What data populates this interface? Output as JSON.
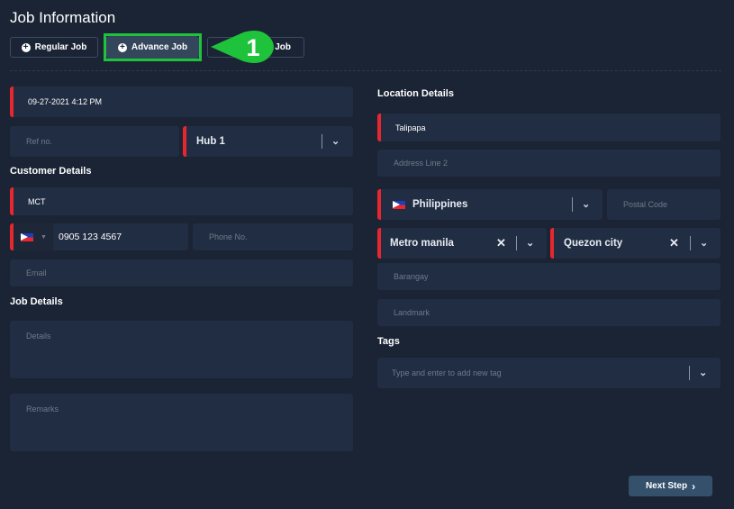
{
  "header": {
    "title": "Job Information"
  },
  "job_types": [
    {
      "label": "Regular Job"
    },
    {
      "label": "Advance Job"
    },
    {
      "label": "Job"
    }
  ],
  "annotation": {
    "number": "1",
    "color": "#1fc23b"
  },
  "form": {
    "datetime": "09-27-2021 4:12 PM",
    "ref_placeholder": "Ref no.",
    "hub": "Hub 1",
    "customer_title": "Customer Details",
    "customer_name": "MCT",
    "mobile": "0905 123 4567",
    "phone_placeholder": "Phone No.",
    "email_placeholder": "Email",
    "job_details_title": "Job Details",
    "details_placeholder": "Details",
    "remarks_placeholder": "Remarks",
    "location_title": "Location Details",
    "address1": "Talipapa",
    "address2_placeholder": "Address Line 2",
    "country": "Philippines",
    "postal_placeholder": "Postal Code",
    "region": "Metro manila",
    "city": "Quezon city",
    "barangay_placeholder": "Barangay",
    "landmark_placeholder": "Landmark",
    "tags_title": "Tags",
    "tags_placeholder": "Type and enter to add new tag"
  },
  "footer": {
    "next_label": "Next Step"
  },
  "colors": {
    "background": "#1b2435",
    "field": "#212d42",
    "required": "#e8262d",
    "primary_button": "#34506b"
  }
}
